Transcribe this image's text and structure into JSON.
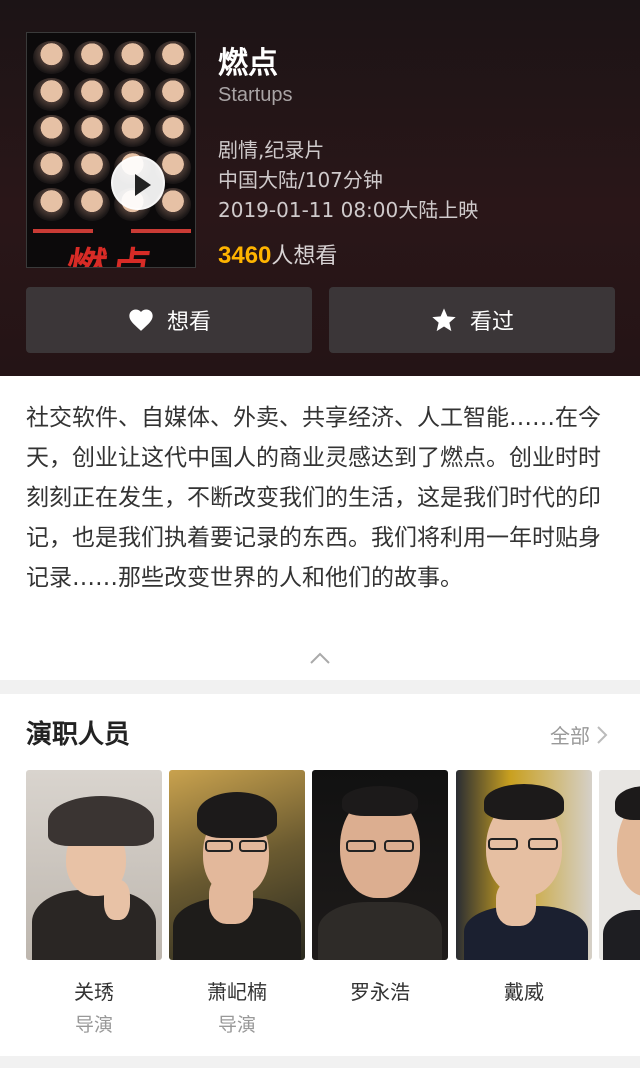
{
  "movie": {
    "title": "燃点",
    "original_title": "Startups",
    "genre": "剧情,纪录片",
    "region_duration": "中国大陆/107分钟",
    "release": "2019-01-11 08:00大陆上映",
    "want_count": "3460",
    "want_suffix": "人想看",
    "poster_title": "燃点"
  },
  "actions": {
    "want_label": "想看",
    "seen_label": "看过"
  },
  "synopsis": "社交软件、自媒体、外卖、共享经济、人工智能……在今天，创业让这代中国人的商业灵感达到了燃点。创业时时刻刻正在发生，不断改变我们的生活，这是我们时代的印记，也是我们执着要记录的东西。我们将利用一年时贴身记录……那些改变世界的人和他们的故事。",
  "cast_section": {
    "title": "演职人员",
    "all_label": "全部",
    "members": [
      {
        "name": "关琇",
        "role": "导演"
      },
      {
        "name": "萧屺楠",
        "role": "导演"
      },
      {
        "name": "罗永浩",
        "role": ""
      },
      {
        "name": "戴威",
        "role": ""
      }
    ]
  },
  "colors": {
    "accent": "#ffb400",
    "header_bg": "#241416",
    "button_bg": "#3b3638"
  }
}
